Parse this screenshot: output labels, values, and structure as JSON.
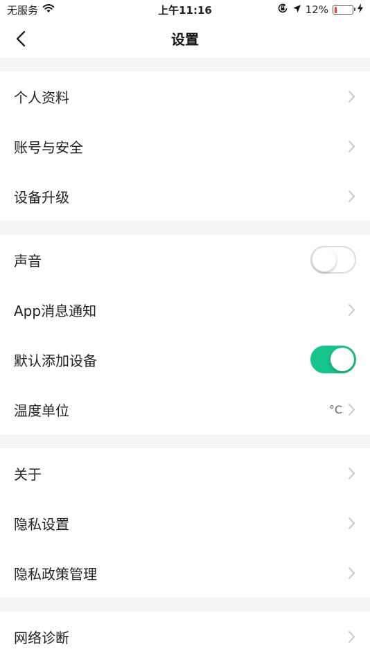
{
  "status_bar": {
    "carrier": "无服务",
    "time": "上午11:16",
    "battery": "12%",
    "battery_level": 0.12,
    "battery_color": "#ff3b30"
  },
  "nav": {
    "title": "设置"
  },
  "sections": [
    {
      "items": [
        {
          "label": "个人资料"
        },
        {
          "label": "账号与安全"
        },
        {
          "label": "设备升级"
        }
      ]
    },
    {
      "items": [
        {
          "label": "声音",
          "toggle": "off"
        },
        {
          "label": "App消息通知"
        },
        {
          "label": "默认添加设备",
          "toggle": "on"
        },
        {
          "label": "温度单位",
          "value": "°C"
        }
      ]
    },
    {
      "items": [
        {
          "label": "关于"
        },
        {
          "label": "隐私设置"
        },
        {
          "label": "隐私政策管理"
        }
      ]
    },
    {
      "items": [
        {
          "label": "网络诊断"
        }
      ]
    }
  ],
  "colors": {
    "accent": "#16c48c",
    "chevron": "#c7c7cc"
  }
}
